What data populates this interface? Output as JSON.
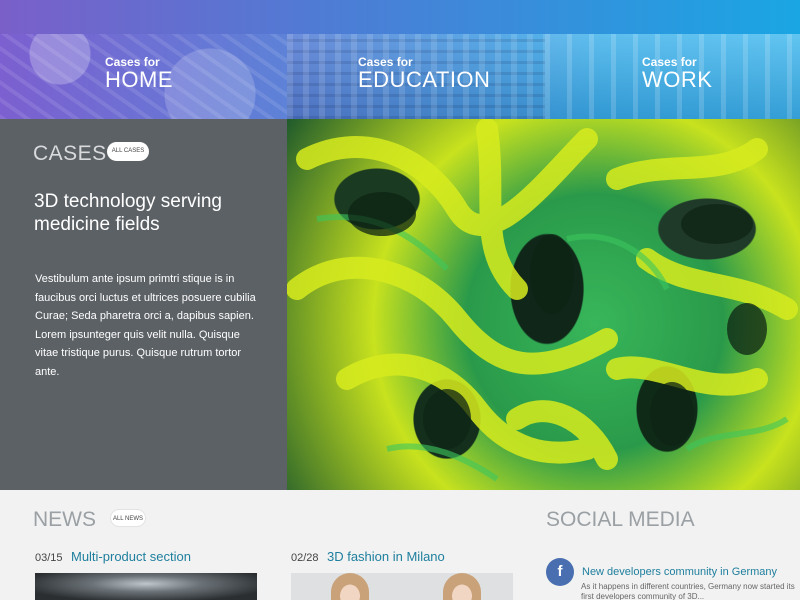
{
  "header": {
    "accent_gradient": [
      "#7a5fc9",
      "#1aa6e3"
    ]
  },
  "case_links": [
    {
      "small": "Cases for",
      "big": "HOME"
    },
    {
      "small": "Cases for",
      "big": "EDUCATION"
    },
    {
      "small": "Cases for",
      "big": "WORK"
    }
  ],
  "cases": {
    "heading": "CASES",
    "all_label": "ALL CASES",
    "featured_title": "3D technology serving medicine fields",
    "featured_body": "Vestibulum ante ipsum primtri stique is in faucibus orci luctus et ultrices posuere cubilia Curae; Seda pharetra orci a, dapibus sapien. Lorem ipsunteger quis velit nulla. Quisque vitae tristique purus. Quisque rutrum tortor ante.",
    "panel_color": "#5c6166"
  },
  "news": {
    "heading": "NEWS",
    "all_label": "ALL NEWS",
    "items": [
      {
        "date": "03/15",
        "title": "Multi-product section"
      },
      {
        "date": "02/28",
        "title": "3D fashion in Milano"
      }
    ]
  },
  "social": {
    "heading": "SOCIAL MEDIA",
    "items": [
      {
        "icon": "facebook-icon",
        "icon_glyph": "f",
        "title": "New developers community in Germany",
        "snippet": "As it happens in different countries, Germany now started its first  developers community of 3D..."
      }
    ]
  },
  "colors": {
    "link": "#1e7f9e",
    "facebook": "#4a6fb0"
  }
}
